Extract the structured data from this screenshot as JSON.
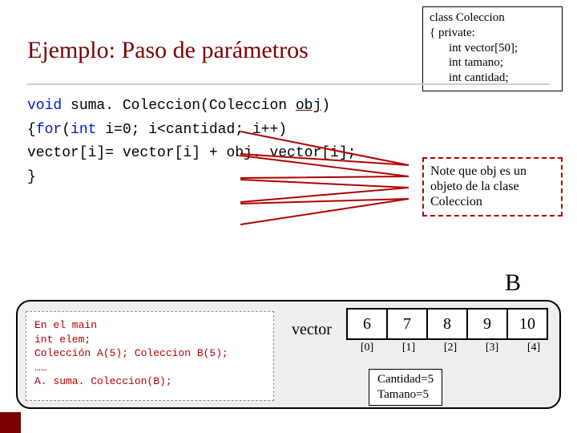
{
  "title": "Ejemplo: Paso de parámetros",
  "class_box": {
    "l1": "class Coleccion",
    "l2": "{ private:",
    "l3": "int vector[50];",
    "l4": "int tamano;",
    "l5": "int cantidad;"
  },
  "code": {
    "kw_void": "void",
    "sig_rest": " suma. Coleccion(Coleccion ",
    "obj": "obj",
    "sig_close": ")",
    "kw_for": "for",
    "kw_int": "int",
    "l2_open": "{",
    "l2_rest1": "(",
    "l2_rest2": " i=0; i<cantidad; i++)",
    "l3": "   vector[i]= vector[i] + obj. vector[i];",
    "l4": "}"
  },
  "note": "Note que obj es un objeto de la clase Coleccion",
  "big_b": "B",
  "main_code": "En el main\nint elem;\nColección A(5); Coleccion B(5);\n……\nA. suma. Coleccion(B);",
  "vector_label": "vector",
  "vector": {
    "values": [
      "6",
      "7",
      "8",
      "9",
      "10"
    ],
    "indices": [
      "[0]",
      "[1]",
      "[2]",
      "[3]",
      "[4]"
    ]
  },
  "ct": {
    "l1": "Cantidad=5",
    "l2": "Tamano=5"
  }
}
